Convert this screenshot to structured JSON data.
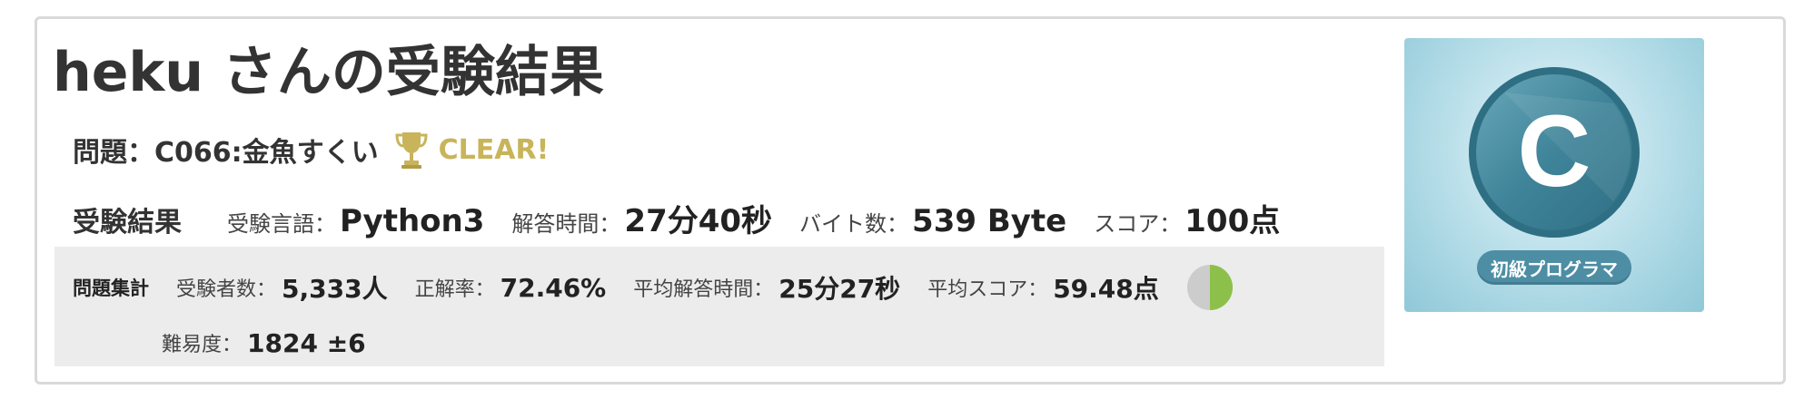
{
  "header": {
    "title": "heku さんの受験結果"
  },
  "problem": {
    "text": "問題：C066:金魚すくい",
    "clear_label": "CLEAR!",
    "trophy_icon": "trophy-icon"
  },
  "result": {
    "heading": "受験結果",
    "language_label": "受験言語：",
    "language": "Python3",
    "time_label": "解答時間：",
    "time": "27分40秒",
    "bytes_label": "バイト数：",
    "bytes": "539 Byte",
    "score_label": "スコア：",
    "score": "100点"
  },
  "stats": {
    "heading": "問題集計",
    "examinees_label": "受験者数：",
    "examinees": "5,333人",
    "accuracy_label": "正解率：",
    "accuracy": "72.46%",
    "avg_time_label": "平均解答時間：",
    "avg_time": "25分27秒",
    "avg_score_label": "平均スコア：",
    "avg_score": "59.48点",
    "pie_fraction": 0.5,
    "pie_colors": {
      "filled": "#8dc04a",
      "empty": "#cccccc"
    },
    "difficulty_label": "難易度：",
    "difficulty": "1824 ±6"
  },
  "badge": {
    "letter": "C",
    "label": "初級プログラマ",
    "colors": {
      "circle": "#3f8499",
      "label_bg": "#4d8ea4"
    }
  },
  "colors": {
    "clear": "#c8b45a",
    "stats_bg": "#ececec",
    "border": "#d9d9d9"
  }
}
